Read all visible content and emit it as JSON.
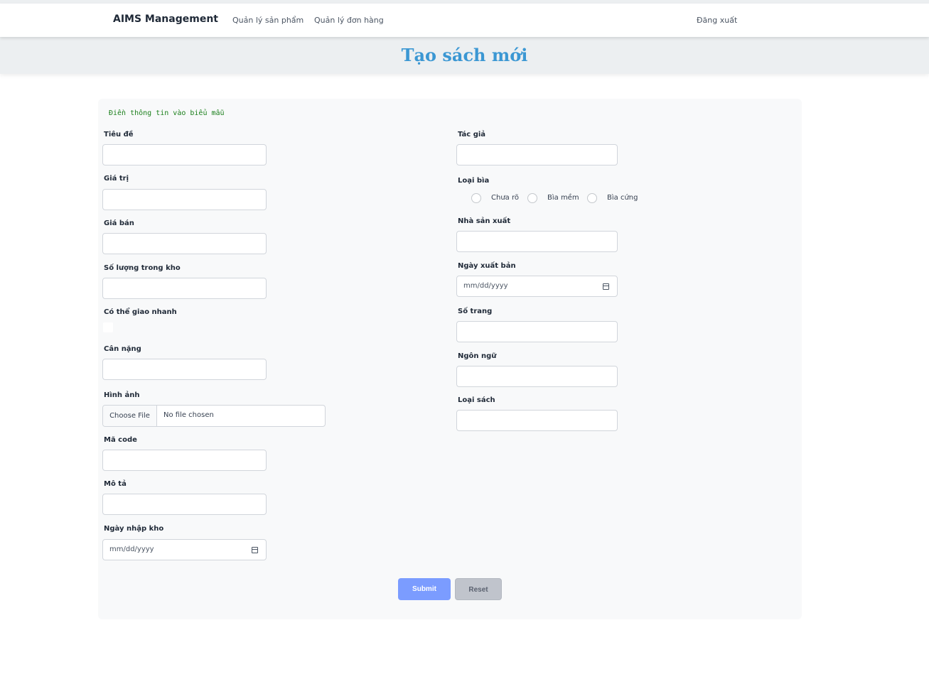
{
  "navbar": {
    "brand": "AIMS Management",
    "links": [
      "Quản lý sản phẩm",
      "Quản lý đơn hàng"
    ],
    "logout": "Đăng xuất"
  },
  "page_title": "Tạo sách mới",
  "form": {
    "hint": "Điền thông tin vào biểu mẫu",
    "left": {
      "title_label": "Tiêu đề",
      "value_label": "Giá trị",
      "price_label": "Giá bán",
      "quantity_label": "Số lượng trong kho",
      "rush_label": "Có thể giao nhanh",
      "rush_checked": false,
      "weight_label": "Cân nặng",
      "image_label": "Hình ảnh",
      "file_button": "Choose File",
      "file_status": "No file chosen",
      "code_label": "Mã code",
      "description_label": "Mô tả",
      "import_date_label": "Ngày nhập kho",
      "import_date_placeholder": "mm/dd/yyyy"
    },
    "right": {
      "author_label": "Tác giả",
      "cover_label": "Loại bìa",
      "cover_options": [
        "Chưa rõ",
        "Bìa mềm",
        "Bìa cứng"
      ],
      "publisher_label": "Nhà sản xuất",
      "publish_date_label": "Ngày xuất bản",
      "publish_date_placeholder": "mm/dd/yyyy",
      "pages_label": "Số trang",
      "language_label": "Ngôn ngữ",
      "genre_label": "Loại sách"
    },
    "submit_label": "Submit",
    "reset_label": "Reset"
  }
}
